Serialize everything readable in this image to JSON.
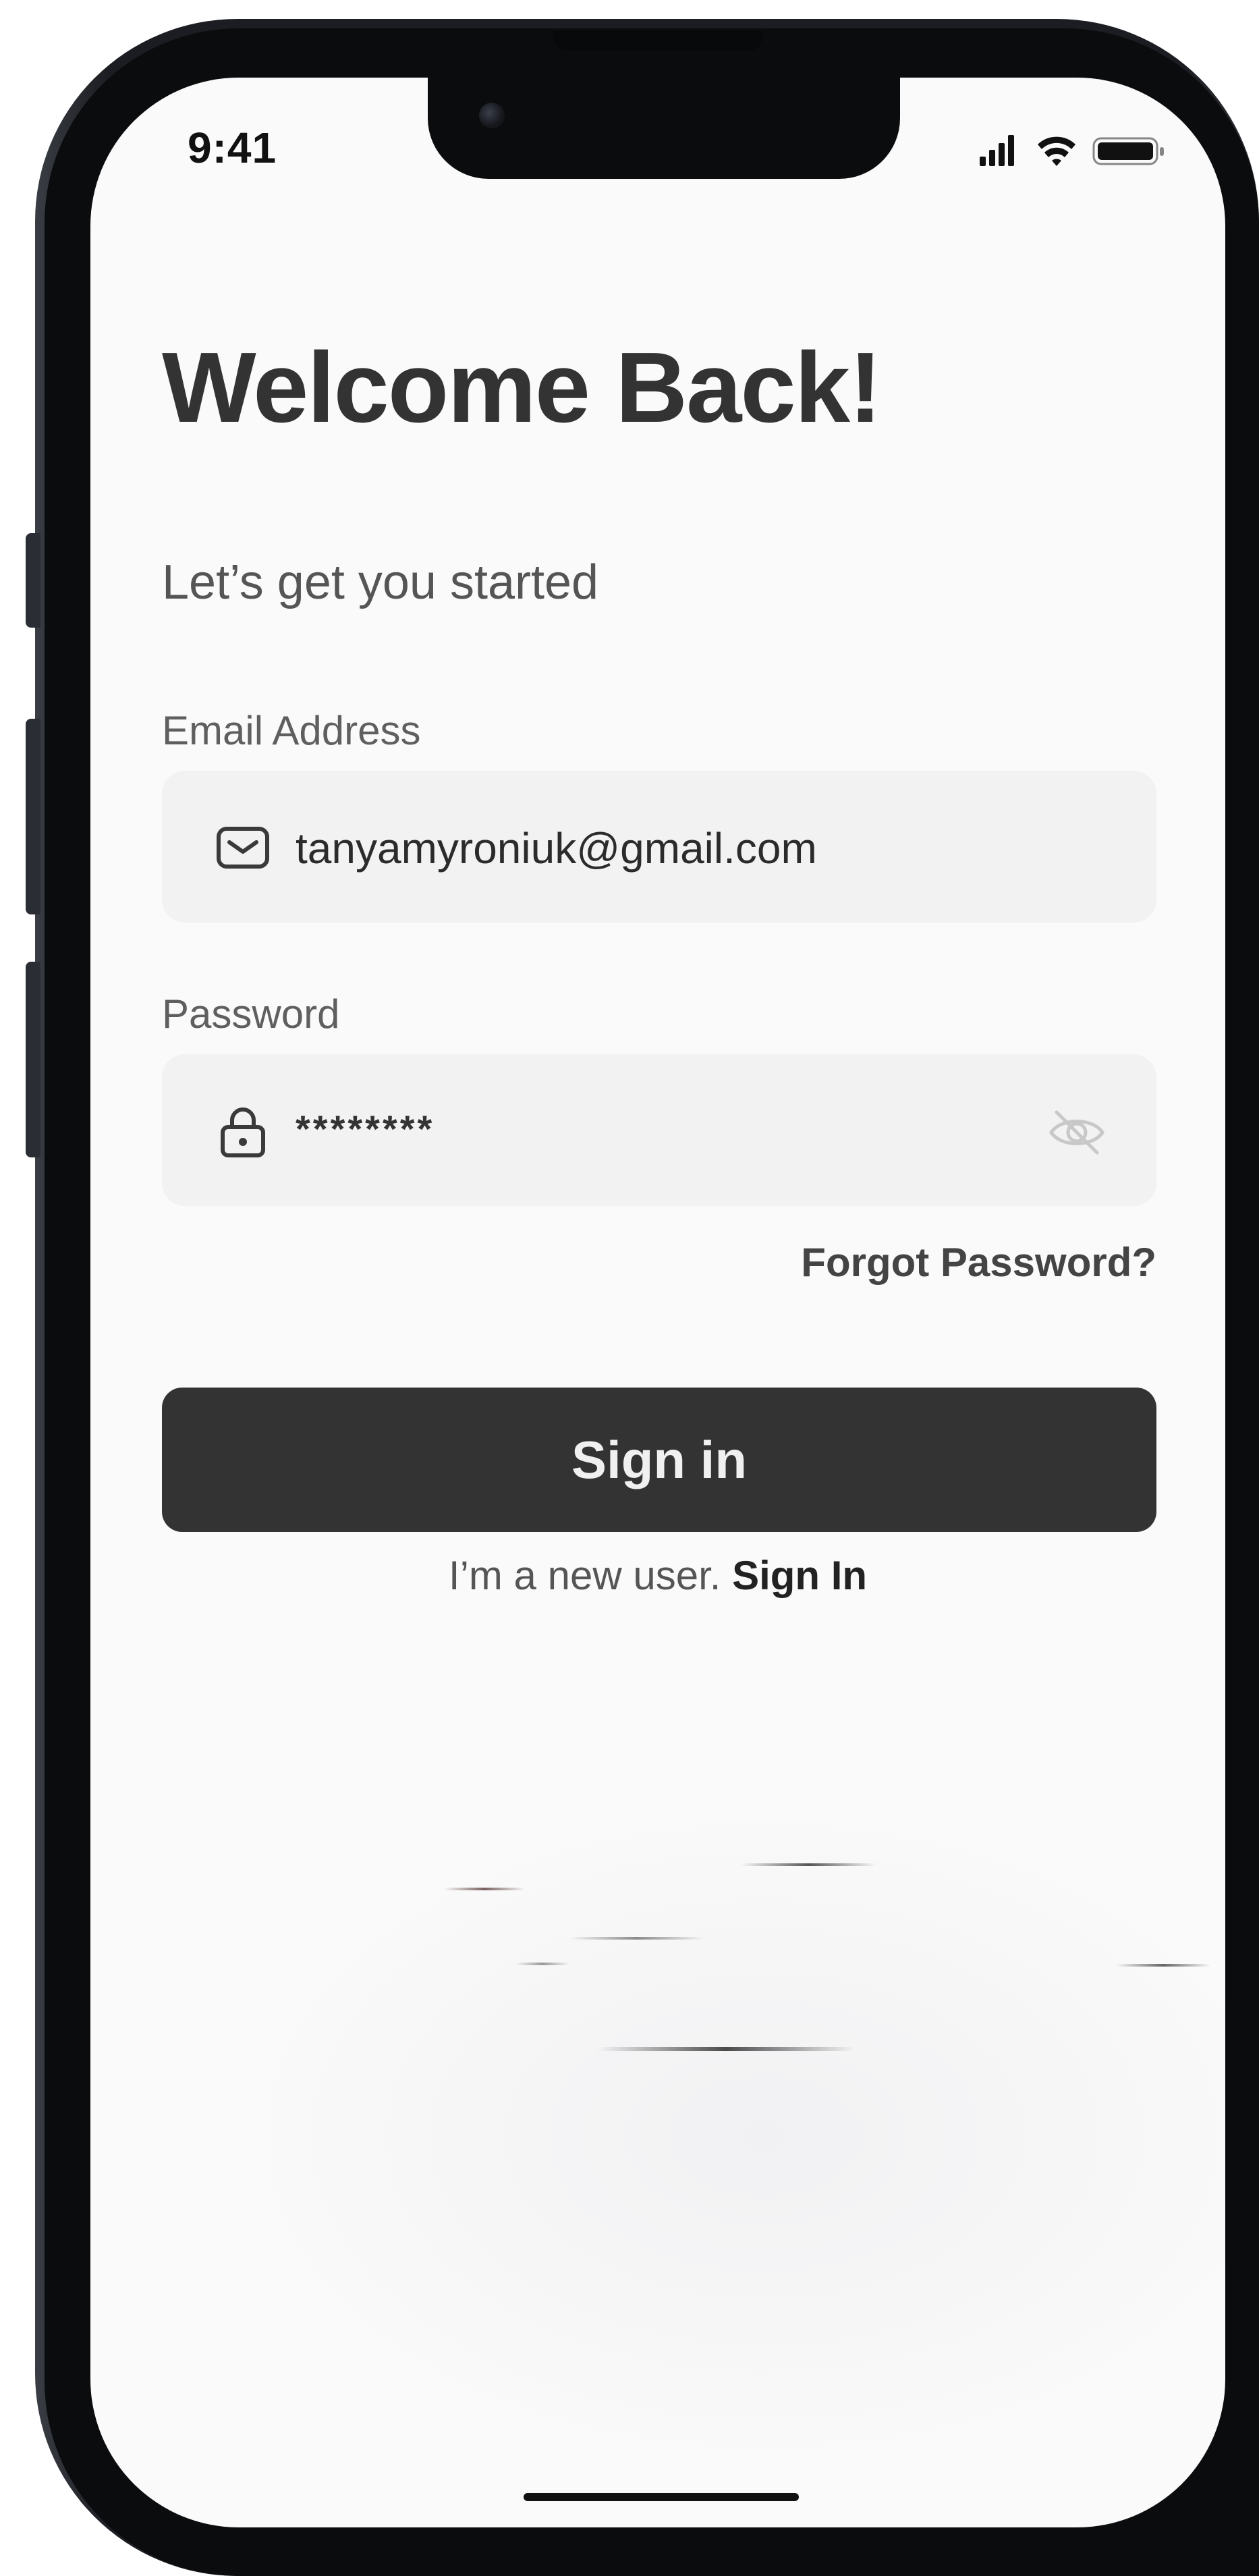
{
  "status_bar": {
    "time": "9:41",
    "icons": [
      "cellular-signal-icon",
      "wifi-icon",
      "battery-icon"
    ]
  },
  "login": {
    "title": "Welcome Back!",
    "subtitle": "Let’s get you started",
    "email": {
      "label": "Email Address",
      "value": "tanyamyroniuk@gmail.com",
      "icon": "mail-icon"
    },
    "password": {
      "label": "Password",
      "value": "********",
      "icon": "lock-icon",
      "toggle_icon": "eye-off-icon"
    },
    "forgot_password": "Forgot Password?",
    "sign_in_button": "Sign in",
    "new_user_text": "I’m a new user.",
    "new_user_link": "Sign In"
  },
  "colors": {
    "button_bg": "#333333",
    "field_bg": "#f2f2f2",
    "screen_bg": "#fafafa",
    "frame": "#1b1d22"
  }
}
